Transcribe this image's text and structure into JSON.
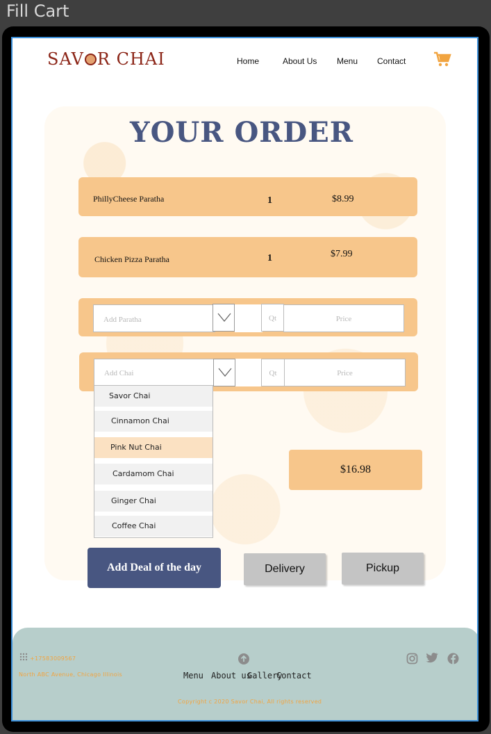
{
  "window": {
    "title": "Fill Cart"
  },
  "brand": {
    "logo_before": "SAV",
    "logo_after": "R CHAI"
  },
  "nav": {
    "home": "Home",
    "about": "About Us",
    "menu": "Menu",
    "contact": "Contact"
  },
  "order": {
    "title": "YOUR ORDER",
    "items": [
      {
        "name": "PhillyCheese Paratha",
        "qty": "1",
        "price": "$8.99"
      },
      {
        "name": "Chicken Pizza Paratha",
        "qty": "1",
        "price": "$7.99"
      }
    ],
    "paratha_placeholder": "Add Paratha",
    "chai_placeholder": "Add Chai",
    "qty_placeholder": "Qt",
    "price_placeholder": "Price",
    "chai_options": [
      "Savor Chai",
      "Cinnamon Chai",
      "Pink Nut Chai",
      "Cardamom Chai",
      "Ginger Chai",
      "Coffee Chai"
    ],
    "highlighted_option": "Pink Nut Chai",
    "total": "$16.98"
  },
  "buttons": {
    "deal": "Add Deal of the day",
    "delivery": "Delivery",
    "pickup": "Pickup"
  },
  "footer": {
    "phone": "+17583009567",
    "address": "North ABC Avenue, Chicago Illinois",
    "nav": [
      "Menu",
      "About us",
      "Gallery",
      "Contact"
    ],
    "copyright": "Copyright c 2020 Savor Chai, All rights reserved"
  },
  "colors": {
    "accent": "#f7c68b",
    "primary": "#485681",
    "footer": "#b7cecb"
  }
}
